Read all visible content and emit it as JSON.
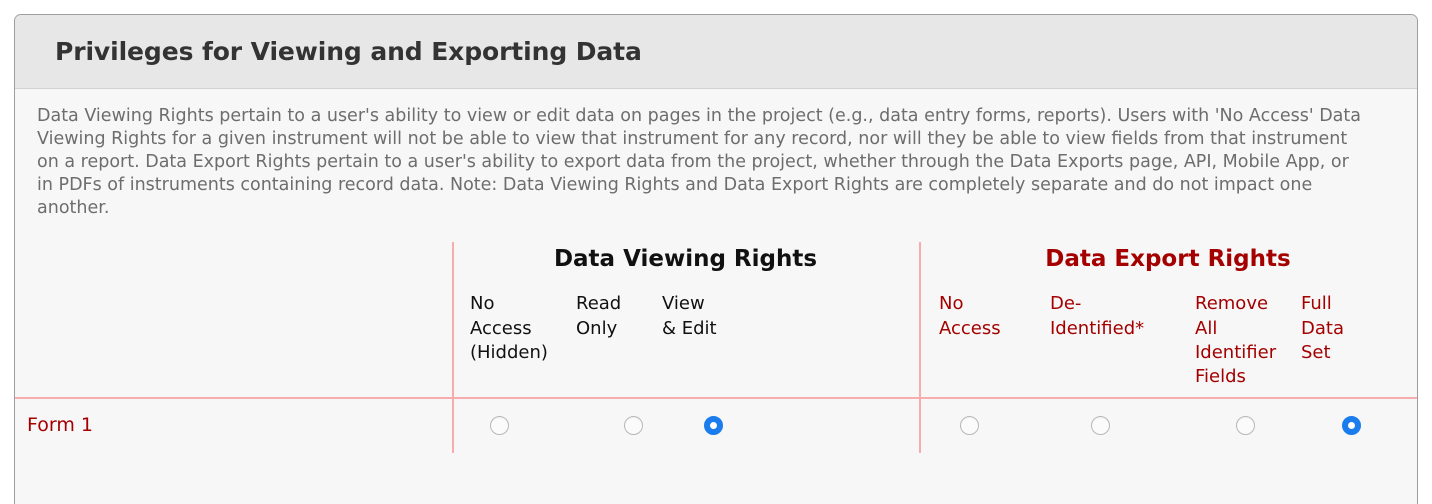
{
  "panel": {
    "title": "Privileges for Viewing and Exporting Data",
    "description": "Data Viewing Rights pertain to a user's ability to view or edit data on pages in the project (e.g., data entry forms, reports). Users with 'No Access' Data Viewing Rights for a given instrument will not be able to view that instrument for any record, nor will they be able to view fields from that instrument on a report. Data Export Rights pertain to a user's ability to export data from the project, whether through the Data Exports page, API, Mobile App, or in PDFs of instruments containing record data. Note: Data Viewing Rights and Data Export Rights are completely separate and do not impact one another."
  },
  "colors": {
    "header_bg": "#e7e7e7",
    "body_bg": "#f7f7f7",
    "border": "#9d9d9d",
    "divider_pink": "#f7adad",
    "red_text": "#a40000",
    "black_text": "#111111",
    "muted_text": "#6d6d6d",
    "radio_checked_blue": "#1b7ced"
  },
  "groups": {
    "viewing": {
      "title": "Data Viewing Rights",
      "options": [
        {
          "label": "No\nAccess\n(Hidden)",
          "value": "no_access_hidden"
        },
        {
          "label": "Read\nOnly",
          "value": "read_only"
        },
        {
          "label": "View\n& Edit",
          "value": "view_edit"
        }
      ]
    },
    "export": {
      "title": "Data Export Rights",
      "options": [
        {
          "label": "No\nAccess",
          "value": "no_access"
        },
        {
          "label": "De-\nIdentified*",
          "value": "de_identified"
        },
        {
          "label": "Remove\nAll\nIdentifier\nFields",
          "value": "remove_identifiers"
        },
        {
          "label": "Full\nData\nSet",
          "value": "full_data_set"
        }
      ]
    }
  },
  "rows": [
    {
      "name": "Form 1",
      "viewing_selected": "view_edit",
      "export_selected": "full_data_set"
    }
  ]
}
